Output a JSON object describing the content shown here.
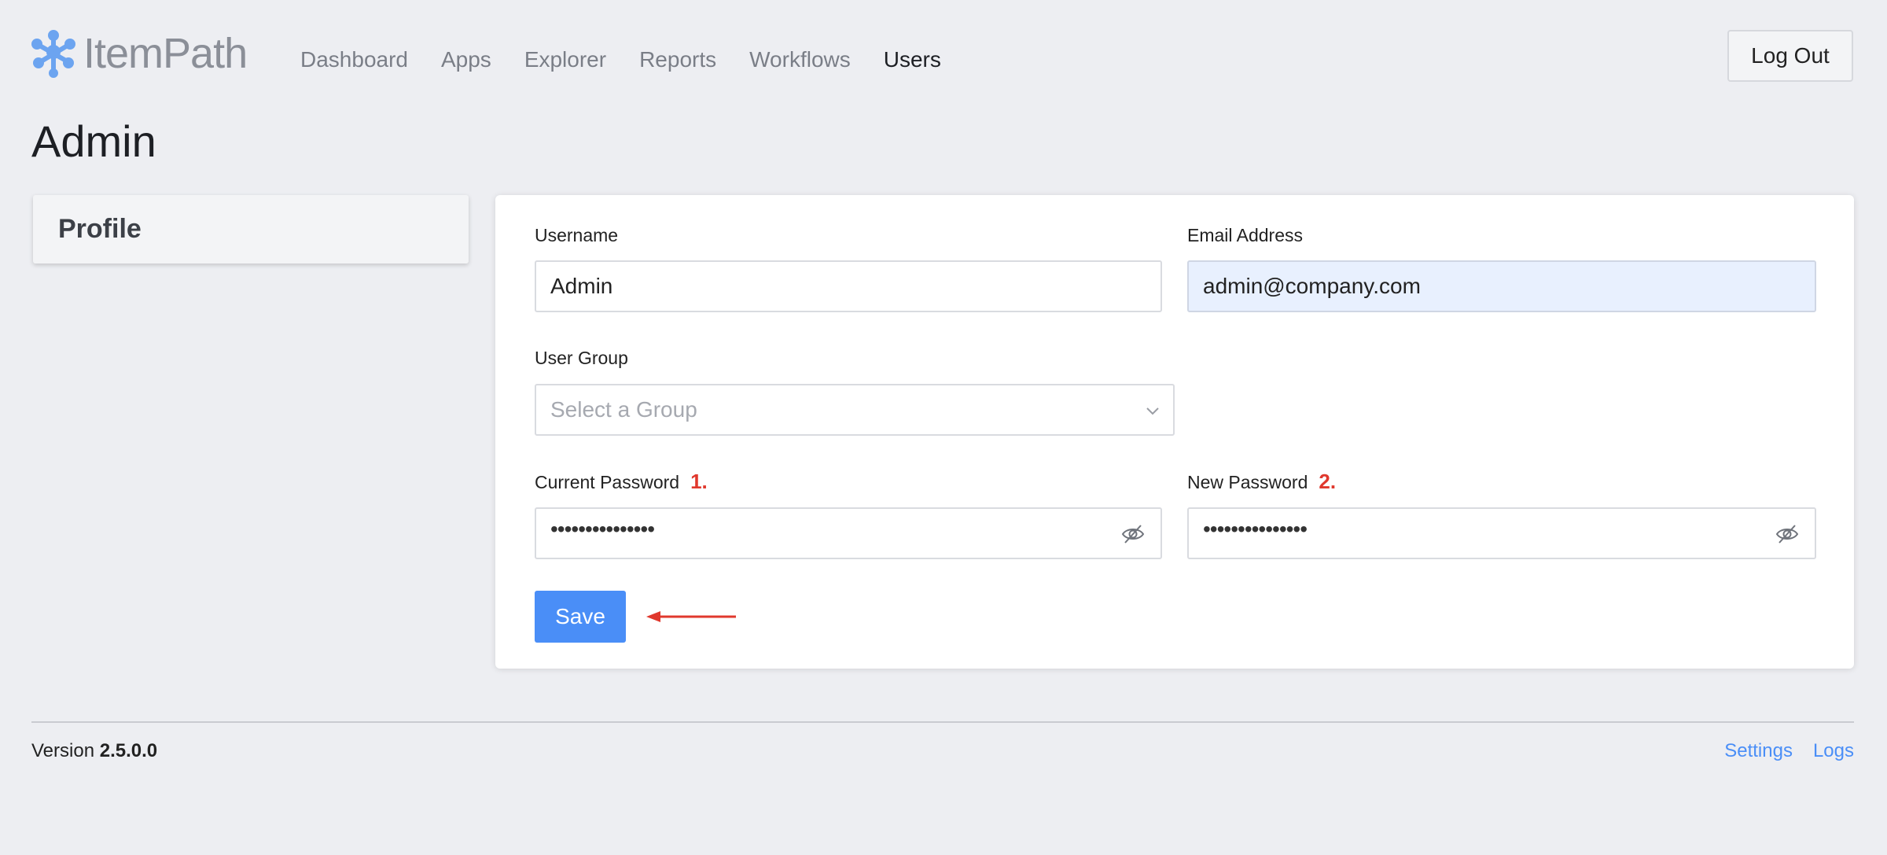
{
  "brand": {
    "name": "ItemPath",
    "logo_icon": "itempath-logo-icon",
    "logo_color": "#6ca4f0"
  },
  "nav": {
    "items": [
      {
        "label": "Dashboard"
      },
      {
        "label": "Apps"
      },
      {
        "label": "Explorer"
      },
      {
        "label": "Reports"
      },
      {
        "label": "Workflows"
      },
      {
        "label": "Users",
        "active": true
      }
    ]
  },
  "header": {
    "logout_label": "Log Out"
  },
  "page": {
    "title": "Admin"
  },
  "sidebar": {
    "items": [
      {
        "label": "Profile"
      }
    ]
  },
  "form": {
    "username": {
      "label": "Username",
      "value": "Admin"
    },
    "email": {
      "label": "Email Address",
      "value": "admin@company.com"
    },
    "user_group": {
      "label": "User Group",
      "placeholder": "Select a Group"
    },
    "current_password": {
      "label": "Current Password",
      "annotation": "1.",
      "value": "•••••••••••••••"
    },
    "new_password": {
      "label": "New Password",
      "annotation": "2.",
      "value": "•••••••••••••••"
    },
    "save_label": "Save",
    "annotation_color": "#e0382d",
    "accent_color": "#4a8ef7"
  },
  "footer": {
    "version_label": "Version",
    "version_value": "2.5.0.0",
    "links": [
      {
        "label": "Settings"
      },
      {
        "label": "Logs"
      }
    ]
  }
}
